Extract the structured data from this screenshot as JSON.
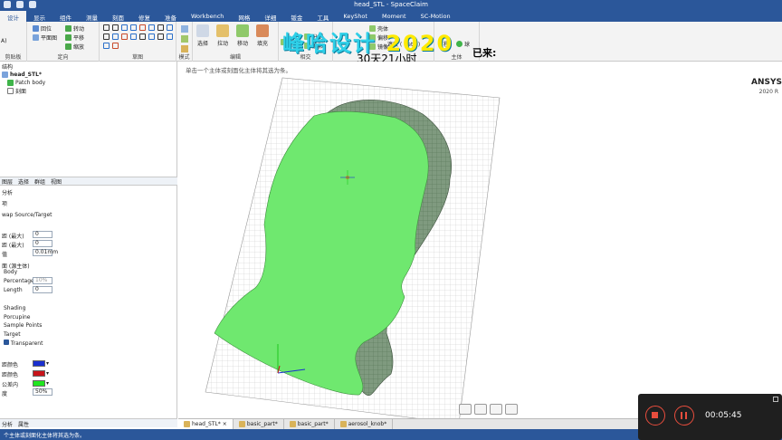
{
  "window": {
    "title": "head_STL - SpaceClaim"
  },
  "tabs": [
    "设计",
    "显示",
    "组件",
    "测量",
    "刻面",
    "修复",
    "准备",
    "Workbench",
    "网格",
    "详细",
    "钣金",
    "工具",
    "KeyShot",
    "Moment",
    "SC-Motion"
  ],
  "ribbon": {
    "groups": {
      "clipboard_label": "剪贴板",
      "orient_label": "定向",
      "sketch_label": "草图",
      "mode_label": "模式",
      "edit_label": "编辑",
      "intersect_label": "相交",
      "body_label": "主体"
    },
    "orient_items": [
      "回位",
      "平面图",
      "转动",
      "平移",
      "缩放"
    ],
    "edit_buttons": [
      "选择",
      "拉动",
      "移动",
      "填充"
    ],
    "intersect_items": [
      "组合",
      "分割",
      "投影"
    ],
    "misc_items": [
      "壳体",
      "偏移",
      "镜像"
    ],
    "track_label": "遮蔽 ( Beta )",
    "equation_label": "方程",
    "sphere_label": "球",
    "paste_label": "A)"
  },
  "overlay": {
    "watermark_text": "峰哈设计",
    "watermark_year": "2020",
    "arrive_text": "已来:",
    "countdown": "30天21小时"
  },
  "leftpanel": {
    "header": "结构",
    "tree": [
      "head_STL*",
      "Patch body",
      "刻面"
    ],
    "tabs": [
      "图层",
      "选择",
      "群组",
      "视图"
    ],
    "options_header": "分析",
    "options_sub": "项",
    "swap_label": "wap Source/Target",
    "rows": [
      {
        "label": "距 (最大)",
        "value": "0"
      },
      {
        "label": "距 (最大)",
        "value": "0"
      },
      {
        "label": "值",
        "value": "0.01mm"
      }
    ],
    "surface_label": "面 (源主体)",
    "body_label": "Body",
    "percentage_label": "Percentage",
    "percentage_value": "10%",
    "length_label": "Length",
    "length_value": "0",
    "shading_label": "Shading",
    "porcupine_label": "Porcupine",
    "sample_label": "Sample Points",
    "target_label": "Target",
    "transparent_label": "Transparent",
    "color_rows": [
      "距颜色",
      "距颜色",
      "公差内"
    ],
    "opacity_label": "度",
    "opacity_value": "50%",
    "bottom_tabs": [
      "分析",
      "属性"
    ]
  },
  "canvas": {
    "hint": "单击一个主体或刻面化主体将其选为条。",
    "brand": "ANSYS",
    "brand_sub": "2020 R"
  },
  "doctabs": [
    "head_STL*",
    "basic_part*",
    "basic_part*",
    "aerosol_knob*"
  ],
  "status": {
    "text": "个主体或刻面化主体将其选为条。"
  },
  "recorder": {
    "time": "00:05:45"
  },
  "colors": {
    "accent": "#2b579a",
    "mesh_green": "#6fe86f",
    "far_color": "#1a2fcf",
    "near_color": "#c8141a",
    "tol_color": "#1fe61f"
  }
}
